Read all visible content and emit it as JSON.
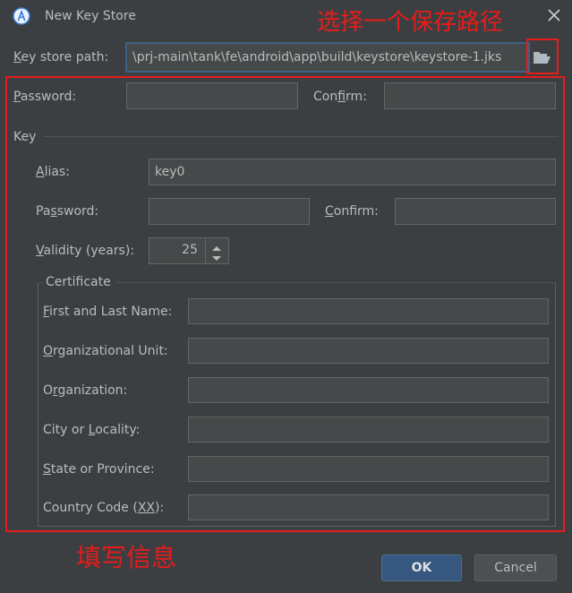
{
  "window": {
    "title": "New Key Store",
    "close_glyph": "✕",
    "app_icon": "android-studio-icon"
  },
  "keystore": {
    "path_label_pre": "",
    "path_label_mn": "K",
    "path_label_post": "ey store path:",
    "path_value": "\\prj-main\\tank\\fe\\android\\app\\build\\keystore\\keystore-1.jks",
    "browse_icon": "folder-open-icon"
  },
  "store_password": {
    "label_pre": "",
    "label_mn": "P",
    "label_post": "assword:",
    "value": "",
    "confirm_pre": "Con",
    "confirm_mn": "f",
    "confirm_post": "irm:",
    "confirm_value": ""
  },
  "key": {
    "section_label": "Key",
    "alias_pre": "",
    "alias_mn": "A",
    "alias_post": "lias:",
    "alias_value": "key0",
    "password_pre": "Pa",
    "password_mn": "s",
    "password_post": "sword:",
    "password_value": "",
    "confirm_pre": "",
    "confirm_mn": "C",
    "confirm_post": "onfirm:",
    "confirm_value": "",
    "validity_pre": "",
    "validity_mn": "V",
    "validity_post": "alidity (years):",
    "validity_value": "25"
  },
  "certificate": {
    "section_label": "Certificate",
    "fields": [
      {
        "pre": "",
        "mn": "F",
        "post": "irst and Last Name:",
        "value": ""
      },
      {
        "pre": "",
        "mn": "O",
        "post": "rganizational Unit:",
        "value": ""
      },
      {
        "pre": "O",
        "mn": "r",
        "post": "ganization:",
        "value": ""
      },
      {
        "pre": "City or ",
        "mn": "L",
        "post": "ocality:",
        "value": ""
      },
      {
        "pre": "",
        "mn": "S",
        "post": "tate or Province:",
        "value": ""
      },
      {
        "pre": "Country Code (",
        "mn": "XX",
        "post": "):",
        "value": ""
      }
    ]
  },
  "annotations": {
    "select_path": "选择一个保存路径",
    "fill_info": "填写信息"
  },
  "buttons": {
    "ok": "OK",
    "cancel": "Cancel"
  },
  "colors": {
    "background": "#3c3f41",
    "field_bg": "#45494a",
    "annotation_red": "#e81b1b",
    "ok_button": "#365880"
  }
}
